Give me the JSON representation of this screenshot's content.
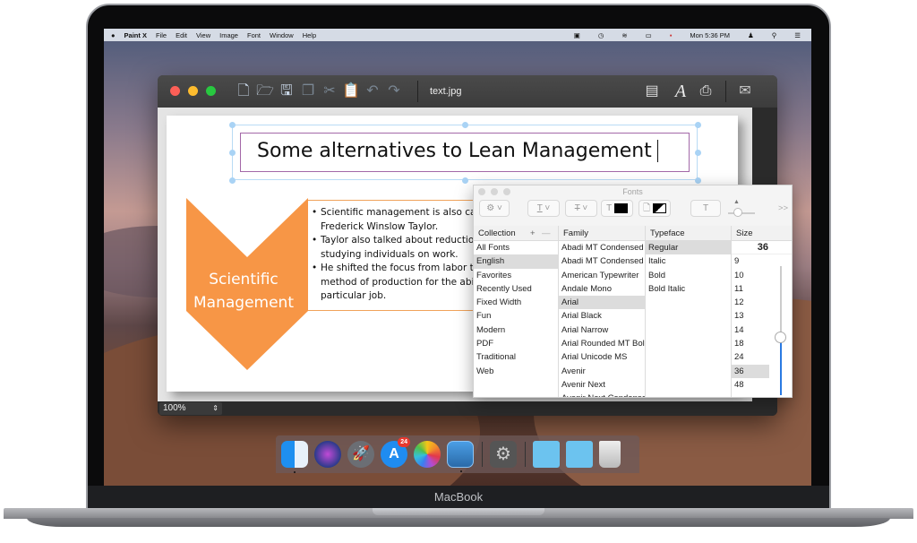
{
  "device": {
    "label": "MacBook"
  },
  "menubar": {
    "apple_icon": "apple-icon",
    "app_name": "Paint X",
    "items": [
      "File",
      "Edit",
      "View",
      "Image",
      "Font",
      "Window",
      "Help"
    ],
    "status_icons": [
      "script-icon",
      "time-machine-icon",
      "wifi-icon",
      "battery-icon",
      "flag-icon"
    ],
    "clock": "Mon 5:36 PM",
    "right_icons": [
      "user-icon",
      "spotlight-icon",
      "notification-center-icon"
    ]
  },
  "window": {
    "title": "text.jpg",
    "toolbar": [
      "new-document-icon",
      "open-folder-icon",
      "save-icon",
      "copy-icon",
      "cut-icon",
      "paste-icon",
      "undo-icon",
      "redo-icon"
    ],
    "right_tools": [
      "layout-icon",
      "font-icon",
      "print-icon",
      "mail-icon"
    ],
    "zoom_level": "100%"
  },
  "slide": {
    "title": "Some alternatives to Lean Management",
    "chevron_label_line1": "Scientific",
    "chevron_label_line2": "Management",
    "bullets": [
      "Scientific management is also called Taylorism after Frederick Winslow Taylor.",
      "Taylor also talked about reduction of waste after studying individuals on work.",
      "He shifted the focus from labor to the adoption of one method of production for the abilities required by a particular job."
    ],
    "colors": {
      "accent": "#f79646",
      "title_border": "#a368a8"
    }
  },
  "fonts_panel": {
    "title": "Fonts",
    "headers": {
      "collection": "Collection",
      "family": "Family",
      "typeface": "Typeface",
      "size": "Size"
    },
    "add_label": "+",
    "remove_label": "—",
    "more_label": ">>",
    "collections": [
      "All Fonts",
      "English",
      "Favorites",
      "Recently Used",
      "Fixed Width",
      "Fun",
      "Modern",
      "PDF",
      "Traditional",
      "Web"
    ],
    "selected_collection": "English",
    "families": [
      "Abadi MT Condensed Extra Bold",
      "Abadi MT Condensed Light",
      "American Typewriter",
      "Andale Mono",
      "Arial",
      "Arial Black",
      "Arial Narrow",
      "Arial Rounded MT Bold",
      "Arial Unicode MS",
      "Avenir",
      "Avenir Next",
      "Avenir Next Condensed"
    ],
    "selected_family": "Arial",
    "typefaces": [
      "Regular",
      "Italic",
      "Bold",
      "Bold Italic"
    ],
    "selected_typeface": "Regular",
    "size_value": "36",
    "sizes": [
      "9",
      "10",
      "11",
      "12",
      "13",
      "14",
      "18",
      "24",
      "36",
      "48"
    ],
    "selected_size": "36",
    "size_slider_fraction": 0.55
  },
  "dock": {
    "apps": [
      "Finder",
      "Siri",
      "Launchpad",
      "App Store",
      "Photos",
      "Paint X",
      "System Preferences",
      "Applications",
      "Downloads",
      "Trash"
    ],
    "app_store_badge": "24"
  }
}
